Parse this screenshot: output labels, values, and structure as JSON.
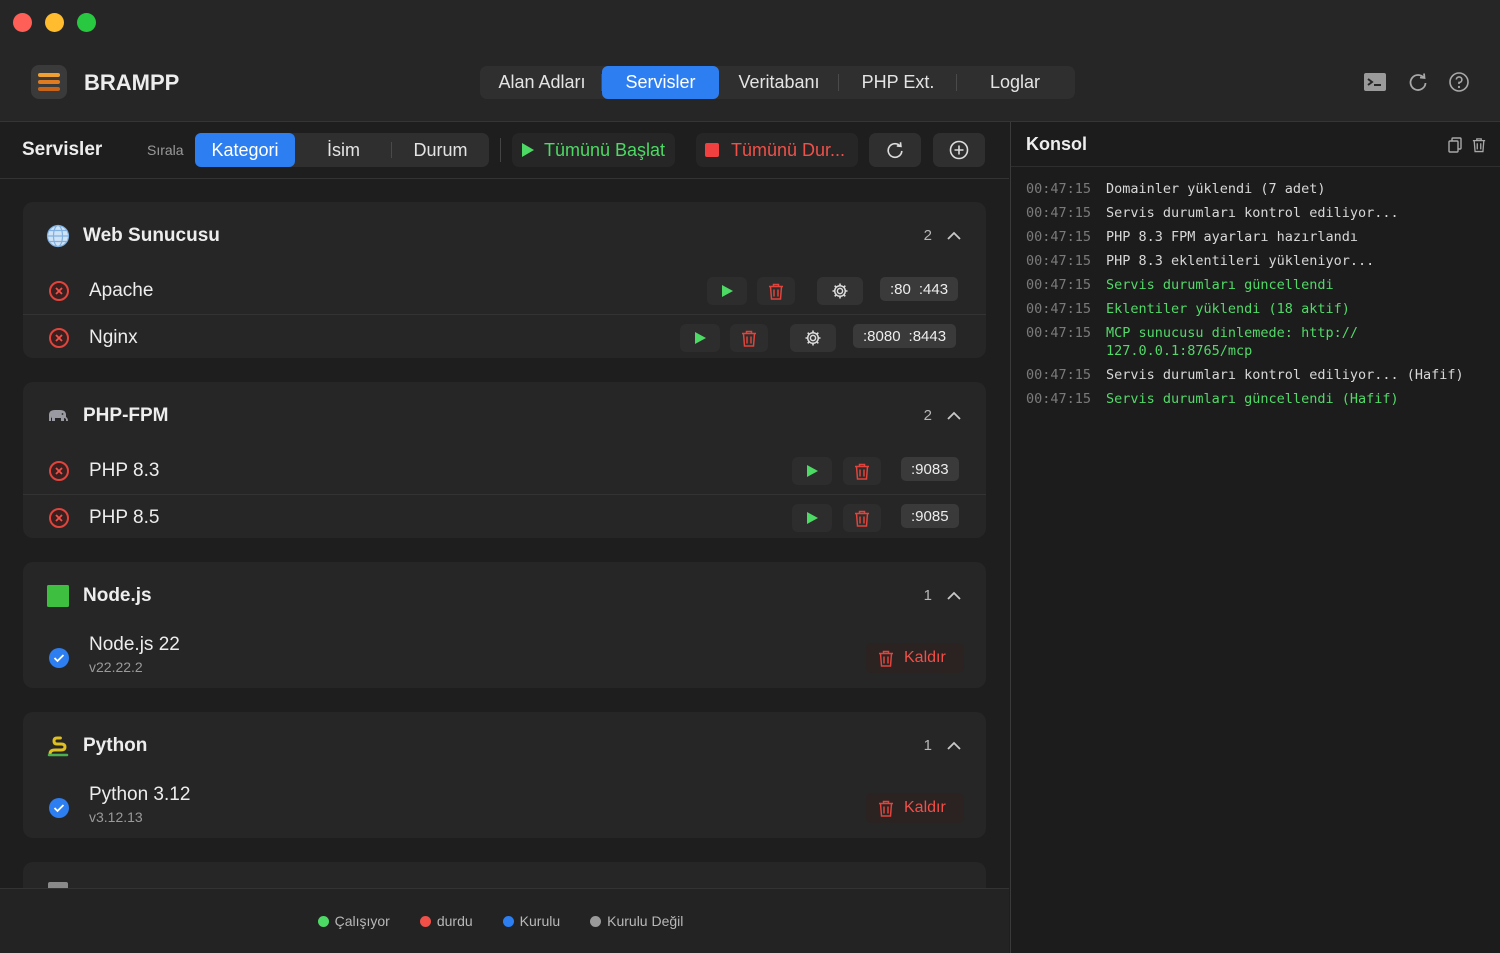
{
  "app": {
    "title": "BRAMPP"
  },
  "main_tabs": [
    {
      "label": "Alan Adları",
      "active": false
    },
    {
      "label": "Servisler",
      "active": true
    },
    {
      "label": "Veritabanı",
      "active": false
    },
    {
      "label": "PHP Ext.",
      "active": false
    },
    {
      "label": "Loglar",
      "active": false
    }
  ],
  "toolbar": {
    "title": "Servisler",
    "sort_label": "Sırala",
    "sort_options": [
      {
        "label": "Kategori",
        "active": true
      },
      {
        "label": "İsim",
        "active": false
      },
      {
        "label": "Durum",
        "active": false
      }
    ],
    "start_all": "Tümünü Başlat",
    "stop_all": "Tümünü Dur..."
  },
  "categories": [
    {
      "title": "Web Sunucusu",
      "count": "2",
      "icon": "globe-icon",
      "items": [
        {
          "name": "Apache",
          "status": "durdu",
          "ports": [
            ":80",
            ":443"
          ]
        },
        {
          "name": "Nginx",
          "status": "durdu",
          "ports": [
            ":8080",
            ":8443"
          ]
        }
      ]
    },
    {
      "title": "PHP-FPM",
      "count": "2",
      "icon": "elephant-icon",
      "items": [
        {
          "name": "PHP 8.3",
          "status": "durdu",
          "ports": [
            ":9083"
          ]
        },
        {
          "name": "PHP 8.5",
          "status": "durdu",
          "ports": [
            ":9085"
          ]
        }
      ]
    },
    {
      "title": "Node.js",
      "count": "1",
      "icon": "nodejs-icon",
      "items": [
        {
          "name": "Node.js 22",
          "version": "v22.22.2",
          "status": "Kurulu",
          "remove": "Kaldır"
        }
      ]
    },
    {
      "title": "Python",
      "count": "1",
      "icon": "snake-icon",
      "items": [
        {
          "name": "Python 3.12",
          "version": "v3.12.13",
          "status": "Kurulu",
          "remove": "Kaldır"
        }
      ]
    }
  ],
  "legend": [
    {
      "label": "Çalışıyor",
      "color": "#4cd964"
    },
    {
      "label": "durdu",
      "color": "#f05048"
    },
    {
      "label": "Kurulu",
      "color": "#2d7ef0"
    },
    {
      "label": "Kurulu Değil",
      "color": "#9a9a9a"
    }
  ],
  "console": {
    "title": "Konsol",
    "lines": [
      {
        "time": "00:47:15",
        "msg": "Domainler yüklendi (7 adet)",
        "type": "info"
      },
      {
        "time": "00:47:15",
        "msg": "Servis durumları kontrol ediliyor...",
        "type": "info"
      },
      {
        "time": "00:47:15",
        "msg": "PHP 8.3 FPM ayarları hazırlandı",
        "type": "info"
      },
      {
        "time": "00:47:15",
        "msg": "PHP 8.3 eklentileri yükleniyor...",
        "type": "info"
      },
      {
        "time": "00:47:15",
        "msg": "Servis durumları güncellendi",
        "type": "success"
      },
      {
        "time": "00:47:15",
        "msg": "Eklentiler yüklendi (18 aktif)",
        "type": "success"
      },
      {
        "time": "00:47:15",
        "msg": "MCP sunucusu dinlemede: http://\n127.0.0.1:8765/mcp",
        "type": "success"
      },
      {
        "time": "00:47:15",
        "msg": "Servis durumları kontrol ediliyor... (Hafif)",
        "type": "info"
      },
      {
        "time": "00:47:15",
        "msg": "Servis durumları güncellendi (Hafif)",
        "type": "success"
      }
    ]
  }
}
